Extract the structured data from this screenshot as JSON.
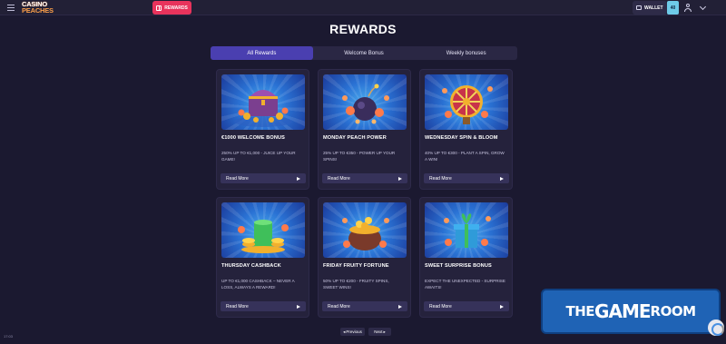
{
  "header": {
    "logo_line1": "CASINO",
    "logo_line2": "PEACHES",
    "rewards_label": "REWARDS",
    "wallet_label": "WALLET",
    "wallet_badge": "40"
  },
  "page": {
    "title": "REWARDS"
  },
  "tabs": [
    {
      "label": "All Rewards",
      "active": true
    },
    {
      "label": "Welcome Bonus",
      "active": false
    },
    {
      "label": "Weekly bonuses",
      "active": false
    }
  ],
  "cards": [
    {
      "title": "€1000 WELCOME BONUS",
      "description": "250% UP TO €1,000 - JUICE UP YOUR GAME!",
      "button": "Read More",
      "art_icon": "treasure-chest-icon"
    },
    {
      "title": "MONDAY PEACH POWER",
      "description": "25% UP TO €350 - POWER UP YOUR SPINS!",
      "button": "Read More",
      "art_icon": "peach-bomb-icon"
    },
    {
      "title": "WEDNESDAY SPIN & BLOOM",
      "description": "40% UP TO €300 - PLANT A SPIN, GROW A WIN!",
      "button": "Read More",
      "art_icon": "wheel-of-fortune-icon"
    },
    {
      "title": "THURSDAY CASHBACK",
      "description": "UP TO €1,000 CASHBACK – NEVER A LOSS, ALWAYS A REWARD!",
      "button": "Read More",
      "art_icon": "coin-stack-icon"
    },
    {
      "title": "FRIDAY FRUITY FORTUNE",
      "description": "50% UP TO €200 - FRUITY SPINS, SWEET WINS!",
      "button": "Read More",
      "art_icon": "coin-cauldron-icon"
    },
    {
      "title": "SWEET SURPRISE BONUS",
      "description": "EXPECT THE UNEXPECTED - SURPRISE AWAITS!",
      "button": "Read More",
      "art_icon": "gift-box-icon"
    }
  ],
  "pagination": {
    "previous": "Previous",
    "next": "Next"
  },
  "footer": {
    "time": "17:03"
  },
  "watermark": {
    "part1": "THE",
    "part2": "GAME",
    "part3": "ROOM"
  }
}
